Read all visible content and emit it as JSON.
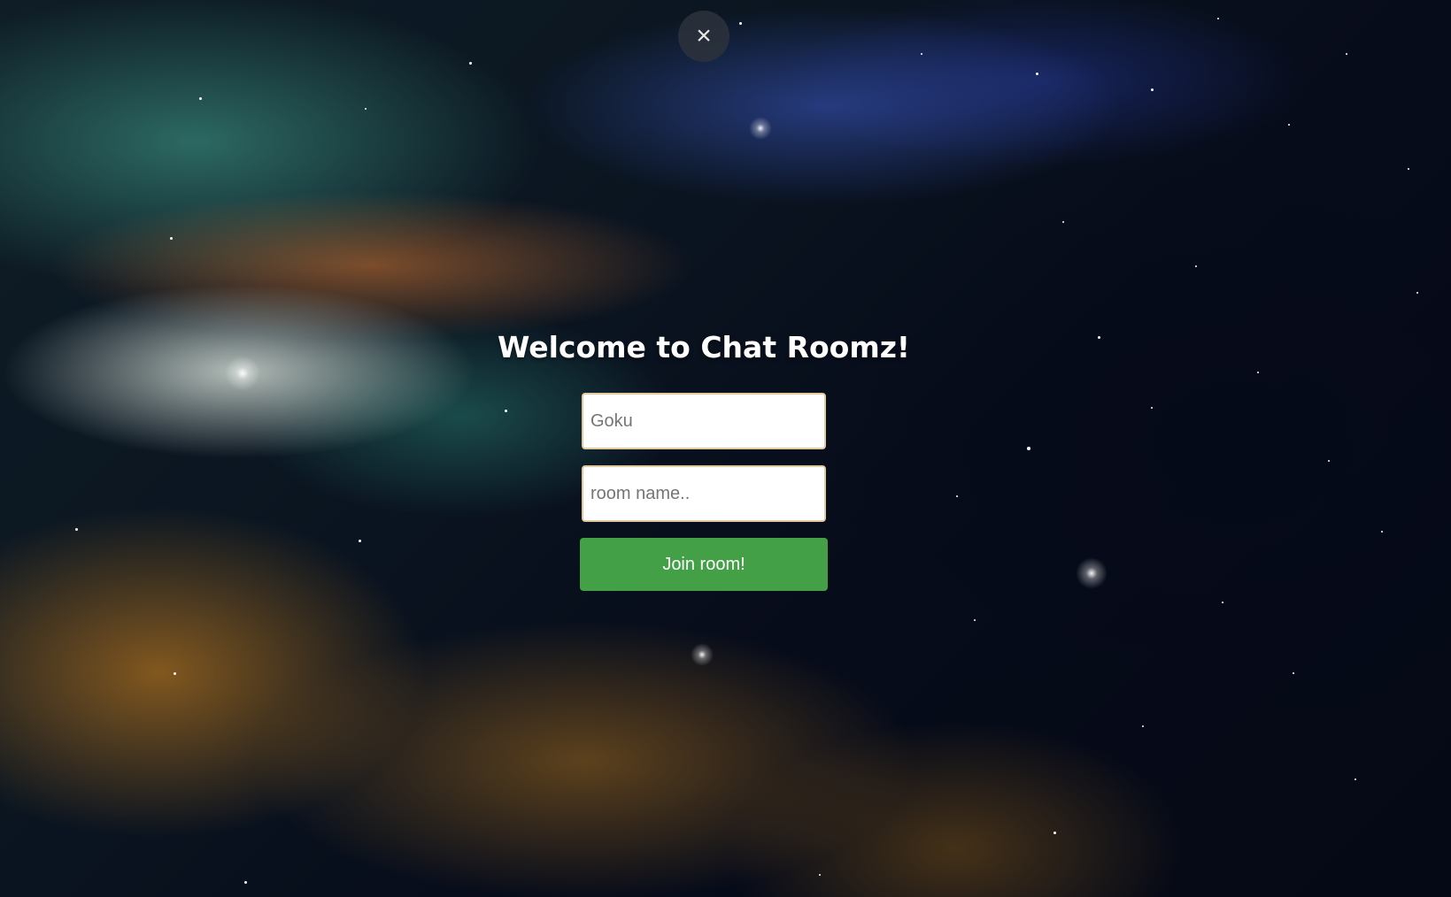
{
  "modal": {
    "close_icon": "×",
    "title": "Welcome to Chat Roomz!",
    "username_input": {
      "placeholder": "Goku",
      "value": ""
    },
    "room_input": {
      "placeholder": "room name..",
      "value": ""
    },
    "join_label": "Join room!"
  },
  "colors": {
    "join_button": "#43a047",
    "input_border": "#e3c9a0",
    "close_button_bg": "#2d323c"
  }
}
